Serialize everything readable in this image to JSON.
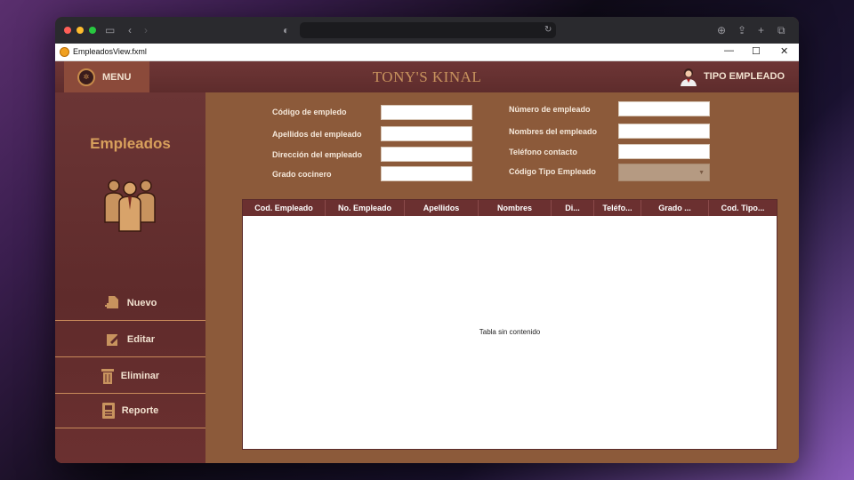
{
  "window": {
    "title": "EmpleadosView.fxml"
  },
  "header": {
    "menu_label": "MENU",
    "brand": "TONY'S KINAL",
    "tipo_label": "TIPO EMPLEADO"
  },
  "sidebar": {
    "title": "Empleados",
    "buttons": [
      {
        "label": "Nuevo",
        "icon": "new-file-icon"
      },
      {
        "label": "Editar",
        "icon": "edit-icon"
      },
      {
        "label": "Eliminar",
        "icon": "trash-icon"
      },
      {
        "label": "Reporte",
        "icon": "report-icon"
      }
    ]
  },
  "form": {
    "codigo": {
      "label": "Código de empledo",
      "value": ""
    },
    "apellidos": {
      "label": "Apellidos del empleado",
      "value": ""
    },
    "direccion": {
      "label": "Dirección del empleado",
      "value": ""
    },
    "grado": {
      "label": "Grado cocinero",
      "value": ""
    },
    "numero": {
      "label": "Número de empleado",
      "value": ""
    },
    "nombres": {
      "label": "Nombres del empleado",
      "value": ""
    },
    "telefono": {
      "label": "Teléfono contacto",
      "value": ""
    },
    "tipo": {
      "label": "Código Tipo Empleado",
      "value": ""
    }
  },
  "table": {
    "columns": [
      "Cod. Empleado",
      "No. Empleado",
      "Apellidos",
      "Nombres",
      "Di...",
      "Teléfo...",
      "Grado ...",
      "Cod. Tipo..."
    ],
    "rows": [],
    "empty_text": "Tabla sin contenido"
  },
  "colors": {
    "background": "#8c5a3a",
    "sidebar": "#5f2b2b",
    "accent": "#c8935e",
    "table_header": "#6b3030"
  }
}
